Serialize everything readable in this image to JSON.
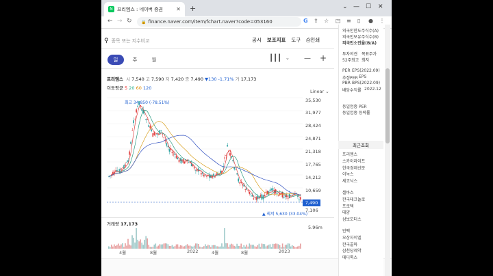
{
  "browser": {
    "tab_title": "프리엠스 : 네이버 증권",
    "favicon_letter": "N",
    "url": "finance.naver.com/item/fchart.naver?code=053160"
  },
  "search": {
    "placeholder": "종목 또는 지수비교"
  },
  "nav": {
    "links": [
      "공시",
      "보조지표",
      "도구",
      "인쇄"
    ]
  },
  "periods": [
    "일",
    "주",
    "월"
  ],
  "ohlc": {
    "name": "프리엠스",
    "open_label": "시",
    "open": "7,540",
    "high_label": "고",
    "high": "7,590",
    "low_label": "저",
    "low": "7,420",
    "close_label": "종",
    "close": "7,490",
    "change": "▼130",
    "change_pct": "-1.71%",
    "volume_label": "거",
    "volume": "17,173"
  },
  "ma": {
    "label": "이동평균",
    "values": [
      "5",
      "20",
      "60",
      "120"
    ]
  },
  "scale": "Linear",
  "y_axis": [
    "35,530",
    "31,977",
    "28,424",
    "24,871",
    "21,318",
    "17,765",
    "14,212",
    "10,659",
    "7,106"
  ],
  "x_axis": [
    "4월",
    "8월",
    "2022",
    "4월",
    "8월",
    "2023"
  ],
  "price_tag": "7,490",
  "annotations": {
    "high": "최고 34,850 (-78.51%)",
    "low": "▲ 최저 5,630 (33.04%)"
  },
  "volume": {
    "title": "거래량",
    "value": "17,173",
    "max": "5.96m"
  },
  "right_panel": {
    "top_items": [
      "외국인한도주식수(A)",
      "외국인보유주식수(B)",
      "외국인소진율(B/A)"
    ],
    "mid_items": [
      "투자의견",
      "목표주가",
      "52주최고",
      "최저"
    ],
    "per_items": [
      "PER",
      "EPS(2022.09)",
      "추정PER",
      "EPS",
      "PBR",
      "BPS(2022.09)",
      "배당수익률",
      "2022.12"
    ],
    "industry": [
      "동일업종 PER",
      "동일업종 등락률"
    ],
    "recent_title": "최근조회",
    "recent": [
      "프리엠스",
      "스카이라이프",
      "한국경제신문",
      "이녹스",
      "세코닉스",
      "셀바스",
      "한국테크놀로",
      "프로텍",
      "태양",
      "삼보모터스",
      "인팩",
      "오상자이엘",
      "한국콜마",
      "삼천당제약",
      "메디톡스"
    ]
  },
  "colors": {
    "accent": "#3a4bb5",
    "up": "#e22222",
    "down": "#1e5fd0",
    "candle_up": "#e04040",
    "candle_down": "#2aa0a0"
  }
}
